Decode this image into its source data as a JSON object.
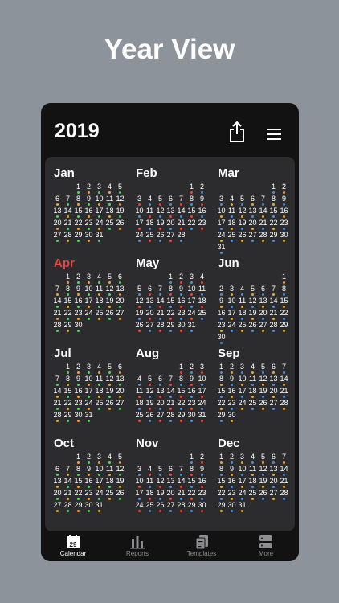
{
  "heading": "Year View",
  "year": "2019",
  "icons": {
    "share": "share-icon",
    "menu": "hamburger-menu-icon"
  },
  "colors": {
    "highlight_month": "#e0454b",
    "dots": [
      "#f5a623",
      "#4a90e2",
      "#f5a623",
      "#4cd964",
      "#ff3b30",
      "#4a90e2"
    ]
  },
  "months": [
    {
      "name": "Jan",
      "startDay": 2,
      "days": 31
    },
    {
      "name": "Feb",
      "startDay": 5,
      "days": 28
    },
    {
      "name": "Mar",
      "startDay": 5,
      "days": 31
    },
    {
      "name": "Apr",
      "startDay": 1,
      "days": 30,
      "highlight": true
    },
    {
      "name": "May",
      "startDay": 3,
      "days": 31
    },
    {
      "name": "Jun",
      "startDay": 6,
      "days": 30
    },
    {
      "name": "Jul",
      "startDay": 1,
      "days": 31
    },
    {
      "name": "Aug",
      "startDay": 4,
      "days": 31
    },
    {
      "name": "Sep",
      "startDay": 0,
      "days": 30
    },
    {
      "name": "Oct",
      "startDay": 2,
      "days": 31
    },
    {
      "name": "Nov",
      "startDay": 5,
      "days": 30
    },
    {
      "name": "Dec",
      "startDay": 0,
      "days": 31
    }
  ],
  "tabs": [
    {
      "label": "Calendar",
      "icon": "calendar-icon",
      "badge": "29",
      "active": true
    },
    {
      "label": "Reports",
      "icon": "bar-chart-icon"
    },
    {
      "label": "Templates",
      "icon": "templates-icon"
    },
    {
      "label": "More",
      "icon": "more-icon"
    }
  ]
}
